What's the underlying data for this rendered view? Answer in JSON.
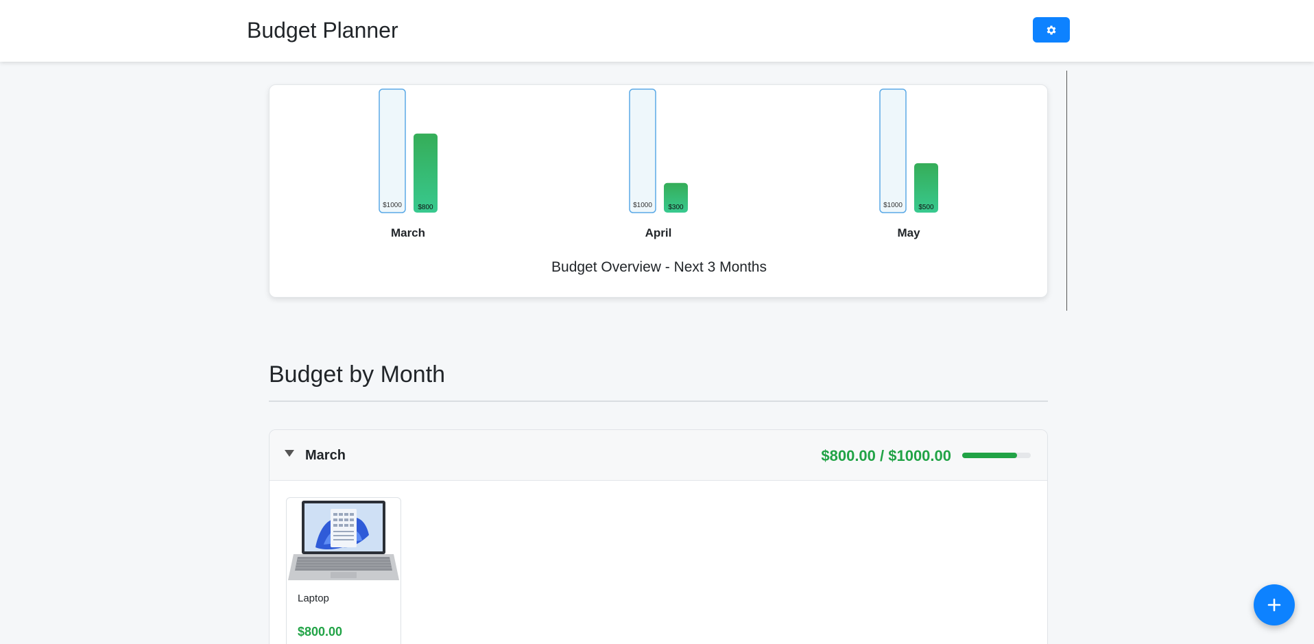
{
  "app": {
    "title": "Budget Planner",
    "settings_icon": "gear-icon"
  },
  "overview": {
    "title": "Budget Overview - Next 3 Months"
  },
  "chart_data": {
    "type": "bar",
    "title": "Budget Overview - Next 3 Months",
    "categories": [
      "March",
      "April",
      "May"
    ],
    "series": [
      {
        "role": "budget",
        "values": [
          1000,
          1000,
          1000
        ],
        "labels": [
          "$1000",
          "$1000",
          "$1000"
        ]
      },
      {
        "role": "spent",
        "values": [
          800,
          300,
          500
        ],
        "labels": [
          "$800",
          "$300",
          "$500"
        ]
      }
    ],
    "ylim": [
      0,
      1000
    ],
    "grid": false,
    "colors": {
      "budget_fill": "#eef7fb",
      "budget_border": "#5aa9e6",
      "spent_top": "#35ad58",
      "spent_bottom": "#38c98f"
    }
  },
  "section": {
    "title": "Budget by Month"
  },
  "months": [
    {
      "name": "March",
      "total_text": "$800.00 / $1000.00",
      "spent_fraction": 0.8,
      "items": [
        {
          "name": "Laptop",
          "price": "$800.00",
          "image": "laptop-image"
        }
      ]
    }
  ],
  "fab": {
    "icon": "plus-icon"
  },
  "colors": {
    "accent": "#0d82ff",
    "success": "#21a346"
  }
}
